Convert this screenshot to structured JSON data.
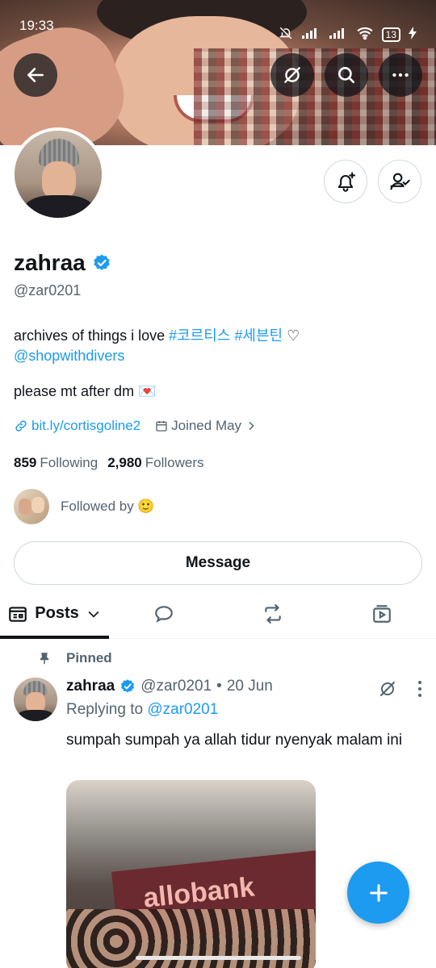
{
  "status_bar": {
    "time": "19:33",
    "battery": "13"
  },
  "colors": {
    "accent": "#1d9bf0",
    "text": "#0f1419",
    "secondary": "#536471",
    "border": "#cfd9de"
  },
  "icons": {
    "back": "arrow-left-icon",
    "grok": "grok-icon",
    "search": "search-icon",
    "more": "more-horizontal-icon",
    "notify": "bell-plus-icon",
    "following": "person-check-icon",
    "verified": "verified-badge-icon"
  },
  "profile": {
    "display_name": "zahraa",
    "handle": "@zar0201",
    "bio_text": "archives of things i love ",
    "bio_hashtag1": "#코르티스",
    "bio_hashtag2": "#세븐틴",
    "bio_heart": "♡",
    "bio_mention": "@shopwithdivers",
    "bio_line2": "please mt after dm 💌",
    "website": "bit.ly/cortisgoline2",
    "joined": "Joined May",
    "following_count": "859",
    "following_label": "Following",
    "followers_count": "2,980",
    "followers_label": "Followers",
    "followed_by": "Followed by 🙂"
  },
  "actions": {
    "message": "Message"
  },
  "tabs": {
    "posts": "Posts"
  },
  "pinned_tweet": {
    "pinned_label": "Pinned",
    "name": "zahraa",
    "handle": "@zar0201",
    "separator": "•",
    "date": "20 Jun",
    "replying_prefix": "Replying to",
    "replying_to": "@zar0201",
    "text": "sumpah sumpah ya allah tidur nyenyak malam ini",
    "media_text": "allobank"
  }
}
